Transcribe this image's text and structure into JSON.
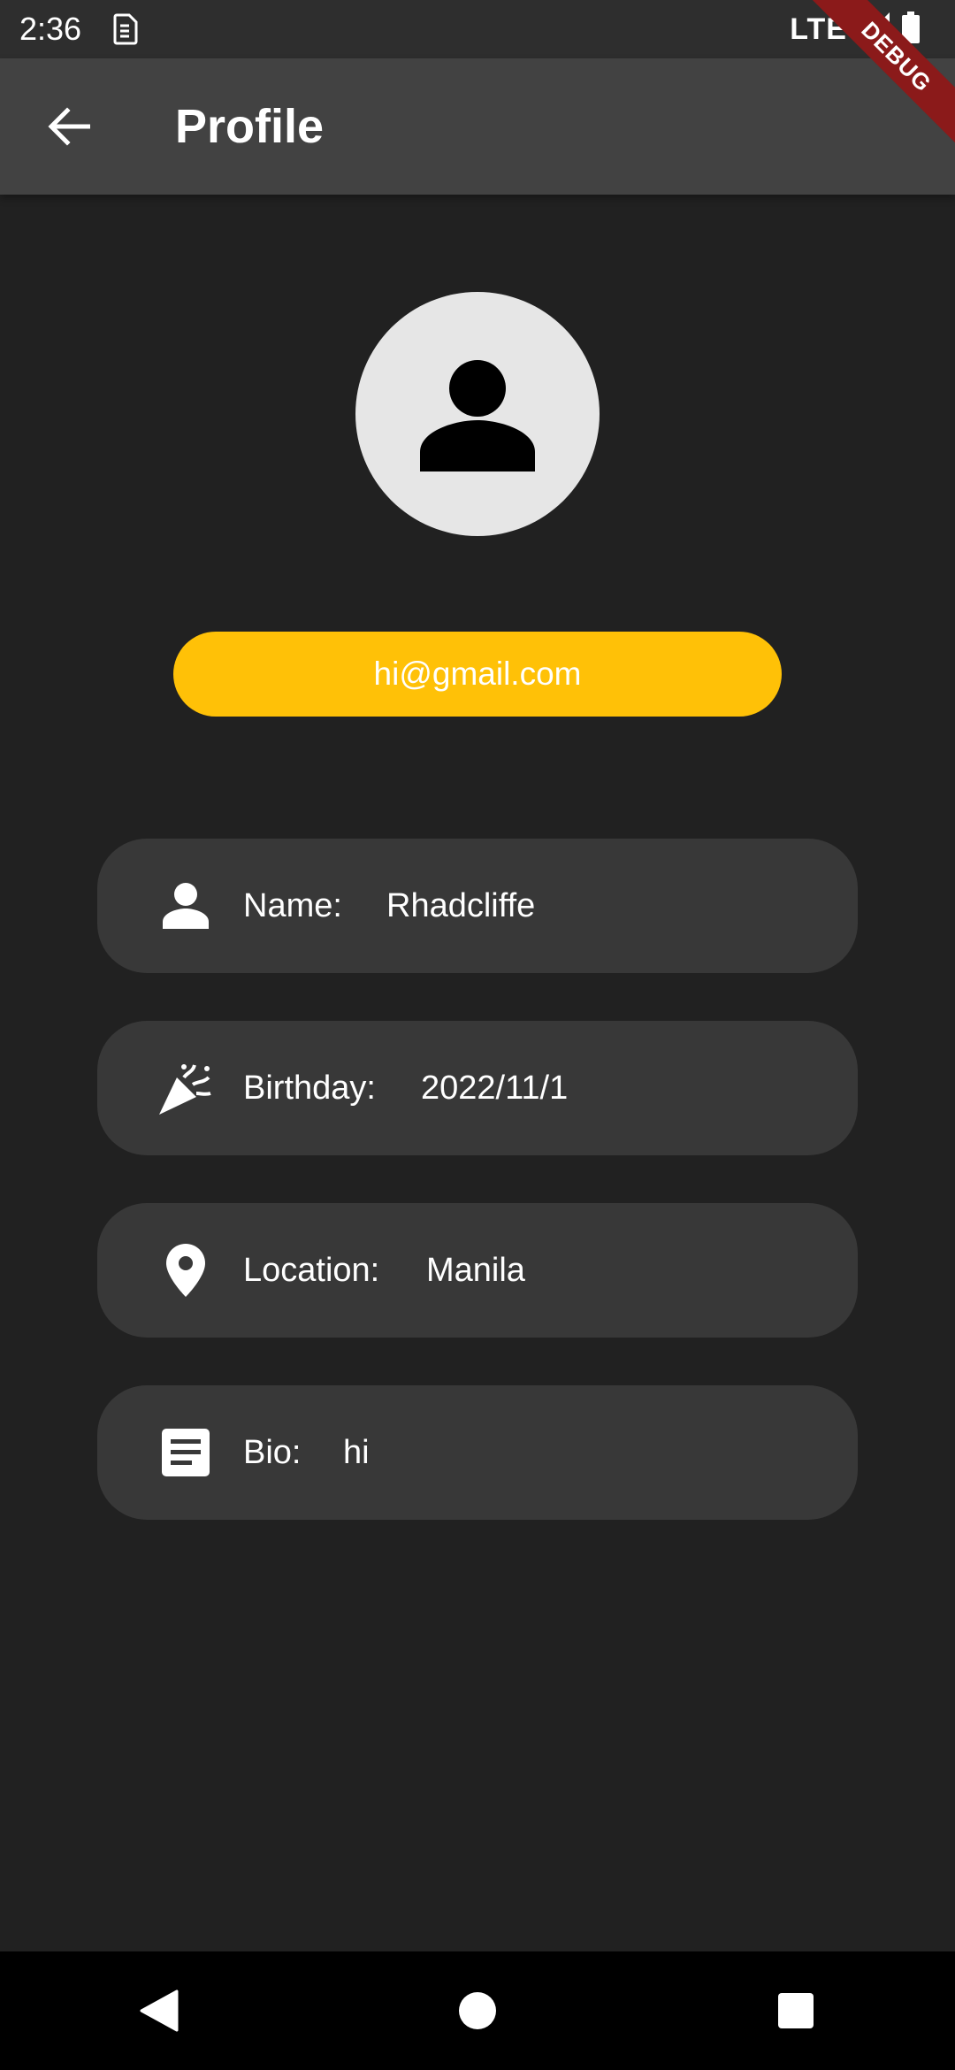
{
  "status_bar": {
    "time": "2:36",
    "network": "LTE"
  },
  "app_bar": {
    "title": "Profile"
  },
  "debug_banner": {
    "text": "DEBUG"
  },
  "profile": {
    "email": "hi@gmail.com",
    "fields": [
      {
        "icon": "person-icon",
        "label": "Name:",
        "value": "Rhadcliffe"
      },
      {
        "icon": "party-popper-icon",
        "label": "Birthday:",
        "value": "2022/11/1"
      },
      {
        "icon": "location-pin-icon",
        "label": "Location:",
        "value": "Manila"
      },
      {
        "icon": "article-icon",
        "label": "Bio:",
        "value": "hi"
      }
    ]
  },
  "colors": {
    "background": "#212121",
    "app_bar": "#424242",
    "card": "#383838",
    "accent": "#ffc107",
    "avatar_bg": "#e6e6e6",
    "debug": "#8b1a1a"
  }
}
